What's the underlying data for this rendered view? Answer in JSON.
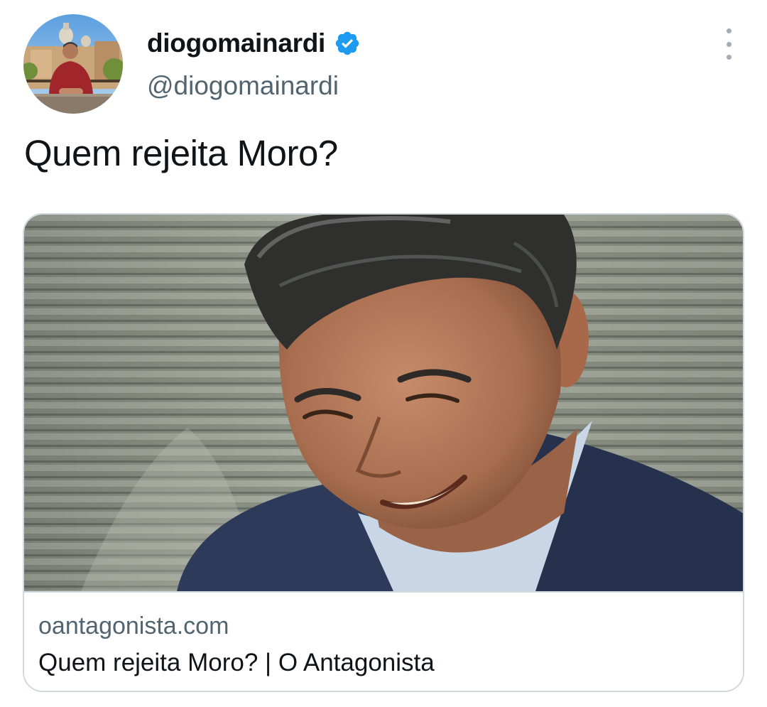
{
  "author": {
    "display_name": "diogomainardi",
    "handle": "@diogomainardi",
    "verified": true,
    "avatar_icon": "profile-photo"
  },
  "tweet": {
    "text": "Quem rejeita Moro?"
  },
  "card": {
    "domain": "oantagonista.com",
    "title": "Quem rejeita Moro? | O Antagonista",
    "image_icon": "article-photo"
  },
  "icons": {
    "verified": "verified-badge-icon",
    "more": "more-options-icon"
  },
  "colors": {
    "text_primary": "#0f1419",
    "text_secondary": "#536471",
    "verified_blue": "#1d9bf0",
    "border": "#cfd9de"
  }
}
